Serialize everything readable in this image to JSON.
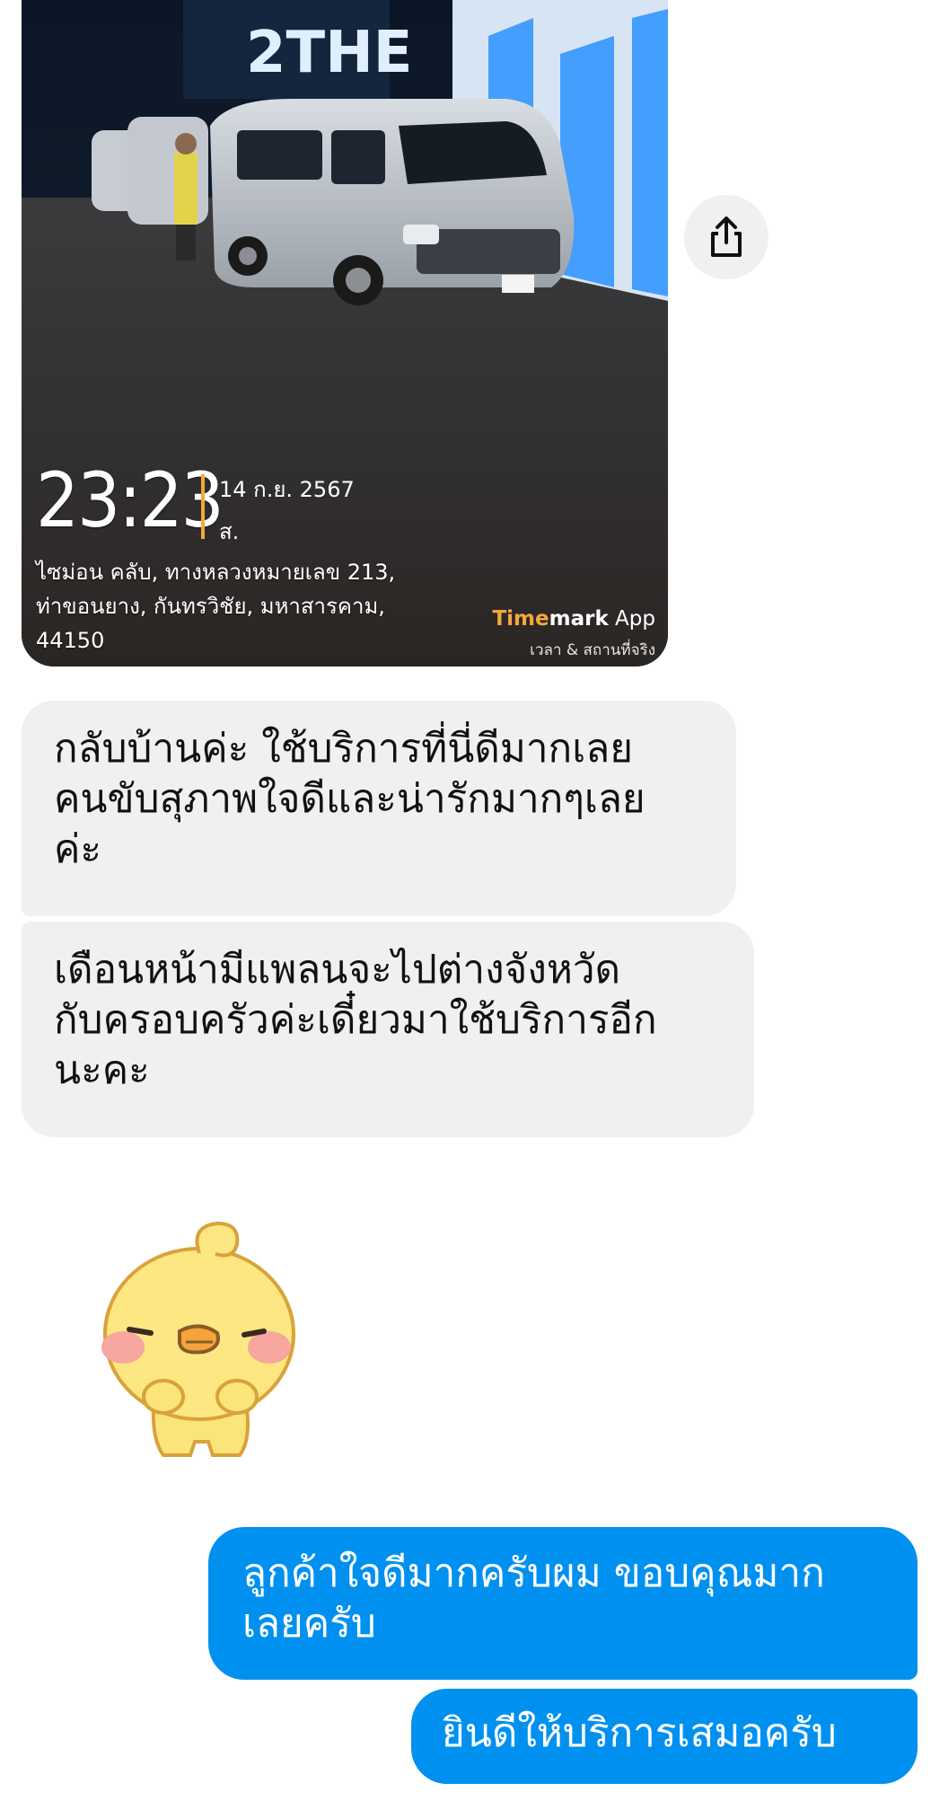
{
  "photo_message": {
    "timestamp_time": "23:23",
    "timestamp_date": "14 ก.ย. 2567",
    "timestamp_day": "ส.",
    "address_lines": [
      "ไซม่อน คลับ, ทางหลวงหมายเลข 213,",
      "ท่าขอนยาง, กันทรวิชัย, มหาสารคาม,",
      "44150"
    ],
    "watermark_brand_orange": "Time",
    "watermark_brand_white": "mark",
    "watermark_brand_suffix": " App",
    "watermark_tagline": "เวลา & สถานที่จริง",
    "sign_text": "2THE"
  },
  "share_button": {
    "icon": "share-icon"
  },
  "messages": [
    {
      "direction": "incoming",
      "text": "กลับบ้านค่ะ ใช้บริการที่นี่ดีมากเลย\nคนขับสุภาพใจดีและน่ารักมากๆเลย\nค่ะ"
    },
    {
      "direction": "incoming",
      "text": "เดือนหน้ามีแพลนจะไปต่างจังหวัด\nกับครอบครัวค่ะเดี๋ยวมาใช้บริการอีก\nนะคะ"
    },
    {
      "direction": "outgoing",
      "text": "ลูกค้าใจดีมากครับผม ขอบคุณมาก\nเลยครับ"
    },
    {
      "direction": "outgoing",
      "text": "ยินดีให้บริการเสมอครับ"
    }
  ],
  "sticker": {
    "icon": "yellow-chick-sticker-icon"
  },
  "colors": {
    "outgoing_bubble": "#0091f0",
    "incoming_bubble": "#f0f0f0",
    "watermark_accent": "#f2a93b"
  }
}
